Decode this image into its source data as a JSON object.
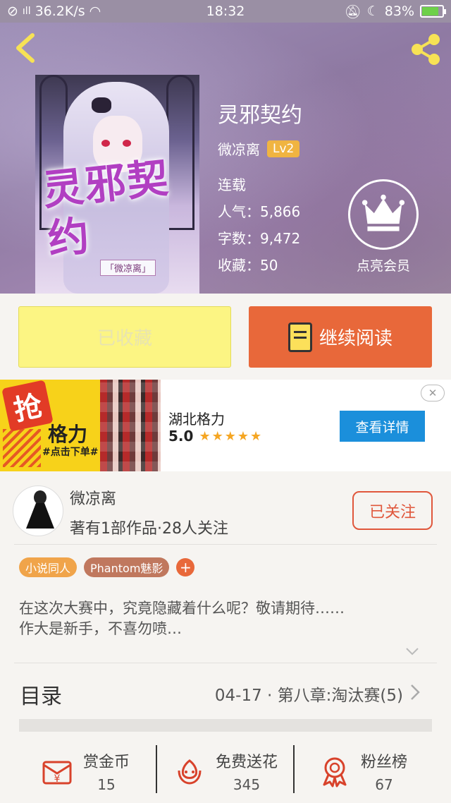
{
  "status_bar": {
    "network": "36.2K/s",
    "time": "18:32",
    "battery": "83%",
    "battery_level": 0.83
  },
  "book": {
    "title": "灵邪契约",
    "author": "微凉离",
    "level": "Lv2",
    "status": "连载",
    "popularity": "人气：5,866",
    "word_count": "字数：9,472",
    "favorites": "收藏：50",
    "cover_title": "灵邪契约",
    "cover_author": "「微凉离」"
  },
  "vip": {
    "label": "点亮会员"
  },
  "actions": {
    "favorited_label": "已收藏",
    "continue_label": "继续阅读"
  },
  "ad": {
    "badge": "抢",
    "brand_art": "格力",
    "cta_art": "#点击下单#",
    "name": "湖北格力",
    "rating": "5.0",
    "stars": "★★★★★",
    "button": "查看详情",
    "close": "✕"
  },
  "author_card": {
    "name": "微凉离",
    "info": "著有1部作品·28人关注",
    "follow_label": "已关注"
  },
  "tags": [
    {
      "label": "小说同人",
      "color": "#f0a44a"
    },
    {
      "label": "Phantom魅影",
      "color": "#c0785e"
    }
  ],
  "tag_add": "+",
  "description": {
    "line1": "在这次大赛中，究竟隐藏着什么呢？敬请期待……",
    "line2": "作大是新手，不喜勿喷…"
  },
  "toc": {
    "label": "目录",
    "latest": "04-17 · 第八章:淘汰赛(5)"
  },
  "stats": [
    {
      "label": "赏金币",
      "value": "15",
      "icon": "reward-coin-icon"
    },
    {
      "label": "免费送花",
      "value": "345",
      "icon": "flower-icon"
    },
    {
      "label": "粉丝榜",
      "value": "67",
      "icon": "medal-icon"
    }
  ],
  "colors": {
    "accent": "#e8683a",
    "favorited_bg": "#fcf583",
    "ad_button": "#1b8fdb",
    "level_badge": "#f0b441"
  }
}
